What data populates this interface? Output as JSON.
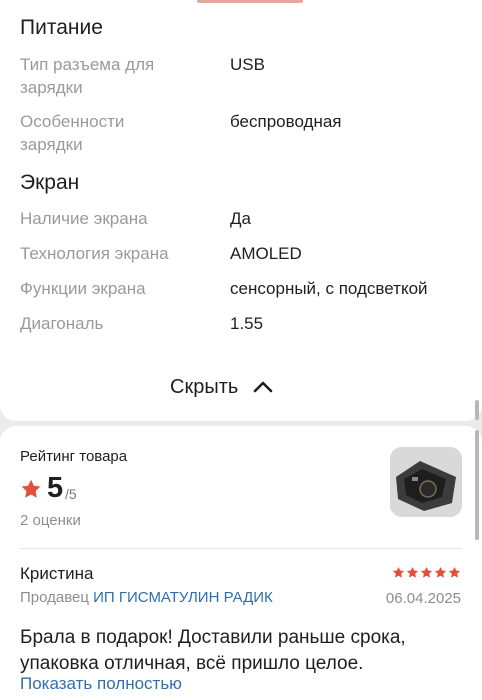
{
  "specs": {
    "power": {
      "title": "Питание",
      "rows": [
        {
          "label": "Тип разъема для зарядки",
          "value": "USB"
        },
        {
          "label": "Особенности зарядки",
          "value": "беспроводная"
        }
      ]
    },
    "screen": {
      "title": "Экран",
      "rows": [
        {
          "label": "Наличие экрана",
          "value": "Да"
        },
        {
          "label": "Технология экрана",
          "value": "AMOLED"
        },
        {
          "label": "Функции экрана",
          "value": "сенсорный, с подсветкой"
        },
        {
          "label": "Диагональ",
          "value": "1.55"
        }
      ]
    },
    "collapse_label": "Скрыть",
    "collapse_icon": "chevron-up-icon"
  },
  "rating": {
    "label": "Рейтинг товара",
    "value": "5",
    "max": "/5",
    "count": "2 оценки",
    "star_color": "#e1503d"
  },
  "review": {
    "author": "Кристина",
    "stars": 5,
    "seller_prefix": "Продавец",
    "seller_name": "ИП ГИСМАТУЛИН РАДИК",
    "date": "06.04.2025",
    "text": "Брала в подарок! Доставили раньше срока, упаковка отличная, всё пришло целое.",
    "show_more": "Показать полностью"
  },
  "colors": {
    "link": "#2f6fb0",
    "muted": "#9a9a9a",
    "star": "#e1503d"
  }
}
